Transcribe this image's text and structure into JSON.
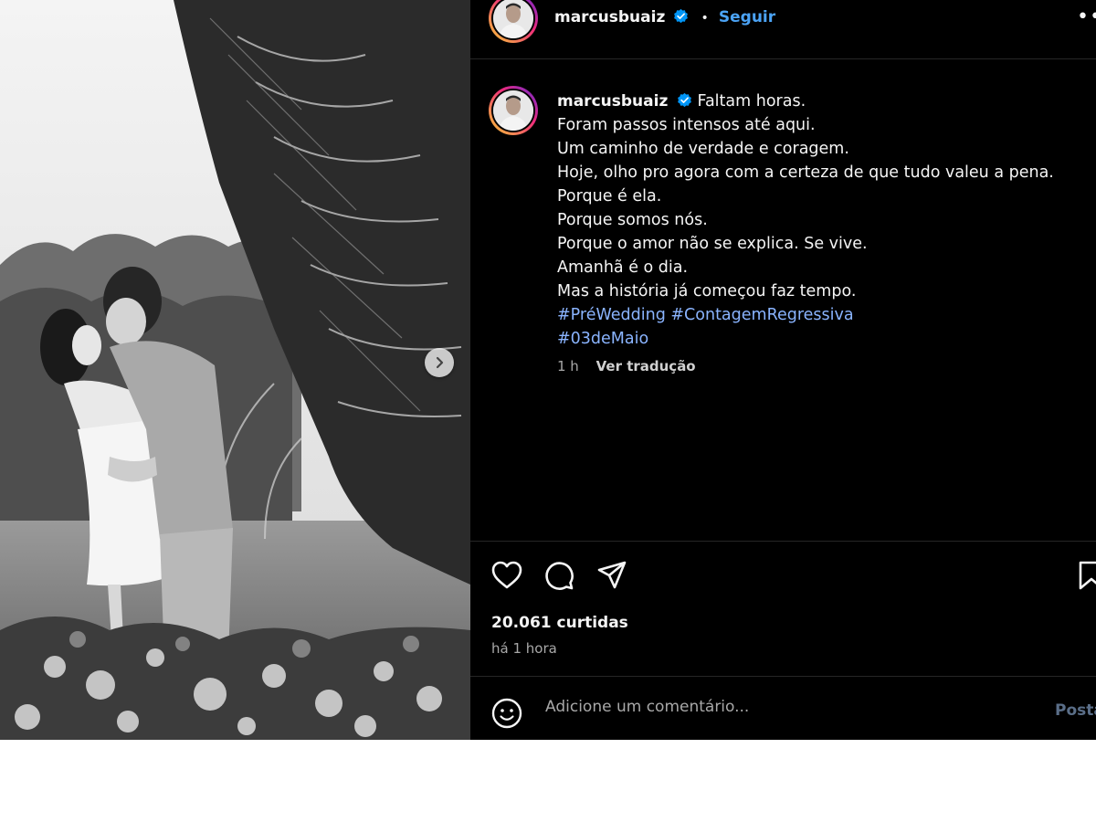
{
  "post": {
    "author": "marcusbuaiz",
    "follow_label": "Seguir",
    "separator": "•",
    "more_icon": "more-horizontal-icon",
    "caption_lines": [
      "Faltam horas.",
      "Foram passos intensos até aqui.",
      "Um caminho de verdade e coragem.",
      "Hoje, olho pro agora com a certeza de que tudo valeu a pena.",
      "Porque é ela.",
      "Porque somos nós.",
      "Porque o amor não se explica. Se vive.",
      "Amanhã é o dia.",
      "Mas a história já começou faz tempo."
    ],
    "hashtags": [
      "#PréWedding",
      "#ContagemRegressiva",
      "#03deMaio"
    ],
    "caption_age": "1 h",
    "translate_label": "Ver tradução",
    "likes_text": "20.061 curtidas",
    "posted_ago": "há 1 hora",
    "comment_placeholder": "Adicione um comentário...",
    "post_label": "Postar",
    "post_label_visible": "Posta"
  },
  "colors": {
    "background": "#000000",
    "link_blue": "#4ba3f5",
    "hashtag": "#8ab4ff",
    "muted": "#a8a8a8",
    "verified_badge": "#0095f6"
  },
  "icons": [
    "like-icon",
    "comment-icon",
    "share-icon",
    "save-icon",
    "emoji-icon",
    "chevron-right-icon",
    "verified-badge-icon"
  ]
}
